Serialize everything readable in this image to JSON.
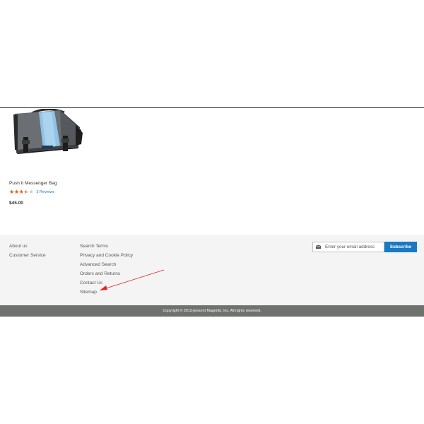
{
  "product": {
    "name": "Push It Messenger Bag",
    "rating_fraction": 0.7,
    "stars": "★★★★★",
    "reviews_link": "3  Reviews",
    "price": "$45.00",
    "image_icon": "messenger-bag-image"
  },
  "footer": {
    "links_left": [
      "About us",
      "Customer Service"
    ],
    "links_middle": [
      "Search Terms",
      "Privacy and Cookie Policy",
      "Advanced Search",
      "Orders and Returns",
      "Contact Us",
      "Sitemap"
    ],
    "newsletter": {
      "placeholder": "Enter your email address",
      "icon": "mail-icon",
      "subscribe_label": "Subscribe"
    },
    "copyright": "Copyright © 2013-present Magento, Inc. All rights reserved."
  },
  "annotation": {
    "arrow_color": "#e82020"
  },
  "colors": {
    "accent": "#1979c3",
    "star": "#ff5501",
    "footer_bg": "#f4f4f4",
    "copyright_bg": "#6e716e"
  }
}
